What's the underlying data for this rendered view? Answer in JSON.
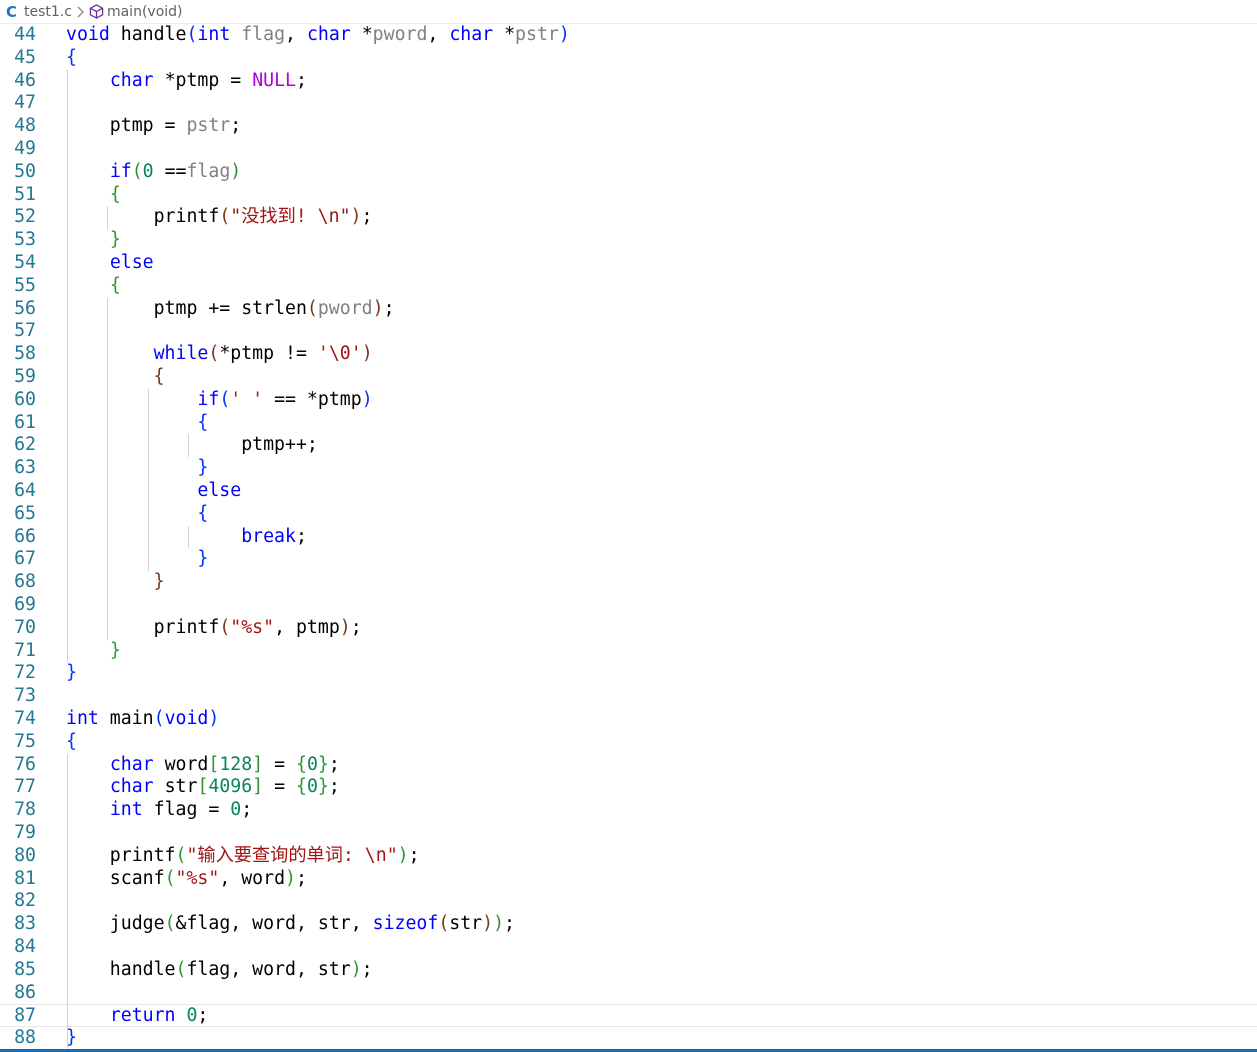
{
  "breadcrumb": {
    "lang_icon": "C",
    "file": "test1.c",
    "separator_icon": "chevron-right-icon",
    "symbol_icon": "cube-icon",
    "symbol": "main(void)"
  },
  "editor": {
    "lines": [
      {
        "n": "44",
        "t": [
          [
            "void",
            "kw"
          ],
          [
            " ",
            ""
          ],
          [
            "handle",
            ""
          ],
          [
            "(",
            "p1"
          ],
          [
            "int",
            "kw"
          ],
          [
            " ",
            ""
          ],
          [
            "flag",
            "par"
          ],
          [
            ", ",
            ""
          ],
          [
            "char",
            "kw"
          ],
          [
            " *",
            ""
          ],
          [
            "pword",
            "par"
          ],
          [
            ", ",
            ""
          ],
          [
            "char",
            "kw"
          ],
          [
            " *",
            ""
          ],
          [
            "pstr",
            "par"
          ],
          [
            ")",
            "p1"
          ]
        ]
      },
      {
        "n": "45",
        "t": [
          [
            "{",
            "p1"
          ]
        ]
      },
      {
        "n": "46",
        "t": [
          [
            "    ",
            ""
          ],
          [
            "char",
            "kw"
          ],
          [
            " *ptmp = ",
            ""
          ],
          [
            "NULL",
            "cst"
          ],
          [
            ";",
            ""
          ]
        ]
      },
      {
        "n": "47",
        "t": []
      },
      {
        "n": "48",
        "t": [
          [
            "    ptmp = ",
            ""
          ],
          [
            "pstr",
            "par"
          ],
          [
            ";",
            ""
          ]
        ]
      },
      {
        "n": "49",
        "t": []
      },
      {
        "n": "50",
        "t": [
          [
            "    ",
            ""
          ],
          [
            "if",
            "ctrl"
          ],
          [
            "(",
            "p2"
          ],
          [
            "0",
            "num"
          ],
          [
            " ==",
            ""
          ],
          [
            "flag",
            "par"
          ],
          [
            ")",
            "p2"
          ]
        ]
      },
      {
        "n": "51",
        "t": [
          [
            "    ",
            ""
          ],
          [
            "{",
            "p2"
          ]
        ]
      },
      {
        "n": "52",
        "t": [
          [
            "        printf",
            ""
          ],
          [
            "(",
            "p3"
          ],
          [
            "\"没找到! \\n\"",
            "str"
          ],
          [
            ")",
            "p3"
          ],
          [
            ";",
            ""
          ]
        ]
      },
      {
        "n": "53",
        "t": [
          [
            "    ",
            ""
          ],
          [
            "}",
            "p2"
          ]
        ]
      },
      {
        "n": "54",
        "t": [
          [
            "    ",
            ""
          ],
          [
            "else",
            "ctrl"
          ]
        ]
      },
      {
        "n": "55",
        "t": [
          [
            "    ",
            ""
          ],
          [
            "{",
            "p2"
          ]
        ]
      },
      {
        "n": "56",
        "t": [
          [
            "        ptmp += strlen",
            ""
          ],
          [
            "(",
            "p3"
          ],
          [
            "pword",
            "par"
          ],
          [
            ")",
            "p3"
          ],
          [
            ";",
            ""
          ]
        ]
      },
      {
        "n": "57",
        "t": []
      },
      {
        "n": "58",
        "t": [
          [
            "        ",
            ""
          ],
          [
            "while",
            "ctrl"
          ],
          [
            "(",
            "p3"
          ],
          [
            "*ptmp != ",
            ""
          ],
          [
            "'\\0'",
            "str"
          ],
          [
            ")",
            "p3"
          ]
        ]
      },
      {
        "n": "59",
        "t": [
          [
            "        ",
            ""
          ],
          [
            "{",
            "p3"
          ]
        ]
      },
      {
        "n": "60",
        "t": [
          [
            "            ",
            ""
          ],
          [
            "if",
            "ctrl"
          ],
          [
            "(",
            "p1"
          ],
          [
            "' '",
            "str"
          ],
          [
            " == *ptmp",
            ""
          ],
          [
            ")",
            "p1"
          ]
        ]
      },
      {
        "n": "61",
        "t": [
          [
            "            ",
            ""
          ],
          [
            "{",
            "p1"
          ]
        ]
      },
      {
        "n": "62",
        "t": [
          [
            "                ptmp++;",
            ""
          ]
        ]
      },
      {
        "n": "63",
        "t": [
          [
            "            ",
            ""
          ],
          [
            "}",
            "p1"
          ]
        ]
      },
      {
        "n": "64",
        "t": [
          [
            "            ",
            ""
          ],
          [
            "else",
            "ctrl"
          ]
        ]
      },
      {
        "n": "65",
        "t": [
          [
            "            ",
            ""
          ],
          [
            "{",
            "p1"
          ]
        ]
      },
      {
        "n": "66",
        "t": [
          [
            "                ",
            ""
          ],
          [
            "break",
            "ctrl"
          ],
          [
            ";",
            ""
          ]
        ]
      },
      {
        "n": "67",
        "t": [
          [
            "            ",
            ""
          ],
          [
            "}",
            "p1"
          ]
        ]
      },
      {
        "n": "68",
        "t": [
          [
            "        ",
            ""
          ],
          [
            "}",
            "p3"
          ]
        ]
      },
      {
        "n": "69",
        "t": []
      },
      {
        "n": "70",
        "t": [
          [
            "        printf",
            ""
          ],
          [
            "(",
            "p3"
          ],
          [
            "\"%s\"",
            "str"
          ],
          [
            ", ptmp",
            ""
          ],
          [
            ")",
            "p3"
          ],
          [
            ";",
            ""
          ]
        ]
      },
      {
        "n": "71",
        "t": [
          [
            "    ",
            ""
          ],
          [
            "}",
            "p2"
          ]
        ]
      },
      {
        "n": "72",
        "t": [
          [
            "}",
            "p1"
          ]
        ]
      },
      {
        "n": "73",
        "t": []
      },
      {
        "n": "74",
        "t": [
          [
            "int",
            "kw"
          ],
          [
            " main",
            ""
          ],
          [
            "(",
            "p1"
          ],
          [
            "void",
            "kw"
          ],
          [
            ")",
            "p1"
          ]
        ]
      },
      {
        "n": "75",
        "t": [
          [
            "{",
            "p1"
          ]
        ]
      },
      {
        "n": "76",
        "t": [
          [
            "    ",
            ""
          ],
          [
            "char",
            "kw"
          ],
          [
            " word",
            ""
          ],
          [
            "[",
            "p2"
          ],
          [
            "128",
            "num"
          ],
          [
            "]",
            "p2"
          ],
          [
            " = ",
            ""
          ],
          [
            "{",
            "p2"
          ],
          [
            "0",
            "num"
          ],
          [
            "}",
            "p2"
          ],
          [
            ";",
            ""
          ]
        ]
      },
      {
        "n": "77",
        "t": [
          [
            "    ",
            ""
          ],
          [
            "char",
            "kw"
          ],
          [
            " str",
            ""
          ],
          [
            "[",
            "p2"
          ],
          [
            "4096",
            "num"
          ],
          [
            "]",
            "p2"
          ],
          [
            " = ",
            ""
          ],
          [
            "{",
            "p2"
          ],
          [
            "0",
            "num"
          ],
          [
            "}",
            "p2"
          ],
          [
            ";",
            ""
          ]
        ]
      },
      {
        "n": "78",
        "t": [
          [
            "    ",
            ""
          ],
          [
            "int",
            "kw"
          ],
          [
            " flag = ",
            ""
          ],
          [
            "0",
            "num"
          ],
          [
            ";",
            ""
          ]
        ]
      },
      {
        "n": "79",
        "t": []
      },
      {
        "n": "80",
        "t": [
          [
            "    printf",
            ""
          ],
          [
            "(",
            "p2"
          ],
          [
            "\"输入要查询的单词: \\n\"",
            "str"
          ],
          [
            ")",
            "p2"
          ],
          [
            ";",
            ""
          ]
        ]
      },
      {
        "n": "81",
        "t": [
          [
            "    scanf",
            ""
          ],
          [
            "(",
            "p2"
          ],
          [
            "\"%s\"",
            "str"
          ],
          [
            ", word",
            ""
          ],
          [
            ")",
            "p2"
          ],
          [
            ";",
            ""
          ]
        ]
      },
      {
        "n": "82",
        "t": []
      },
      {
        "n": "83",
        "t": [
          [
            "    judge",
            ""
          ],
          [
            "(",
            "p2"
          ],
          [
            "&flag, word, str, ",
            ""
          ],
          [
            "sizeof",
            "kw"
          ],
          [
            "(",
            "p3"
          ],
          [
            "str",
            ""
          ],
          [
            ")",
            "p3"
          ],
          [
            ")",
            "p2"
          ],
          [
            ";",
            ""
          ]
        ]
      },
      {
        "n": "84",
        "t": []
      },
      {
        "n": "85",
        "t": [
          [
            "    handle",
            ""
          ],
          [
            "(",
            "p2"
          ],
          [
            "flag, word, str",
            ""
          ],
          [
            ")",
            "p2"
          ],
          [
            ";",
            ""
          ]
        ]
      },
      {
        "n": "86",
        "t": []
      },
      {
        "n": "87",
        "t": [
          [
            "    ",
            ""
          ],
          [
            "return",
            "ctrl"
          ],
          [
            " ",
            ""
          ],
          [
            "0",
            "num"
          ],
          [
            ";",
            ""
          ]
        ]
      },
      {
        "n": "88",
        "t": [
          [
            "}",
            "p1"
          ]
        ]
      }
    ],
    "current_line": "87",
    "colors": {
      "keyword": "#0000ff",
      "string": "#a31515",
      "number": "#098658",
      "constant": "#af00db",
      "parameter": "#808080",
      "line_number": "#237893",
      "bracket_level1": "#0431fa",
      "bracket_level2": "#319331",
      "bracket_level3": "#7b3814",
      "status_bar": "#0e6fbf"
    }
  }
}
